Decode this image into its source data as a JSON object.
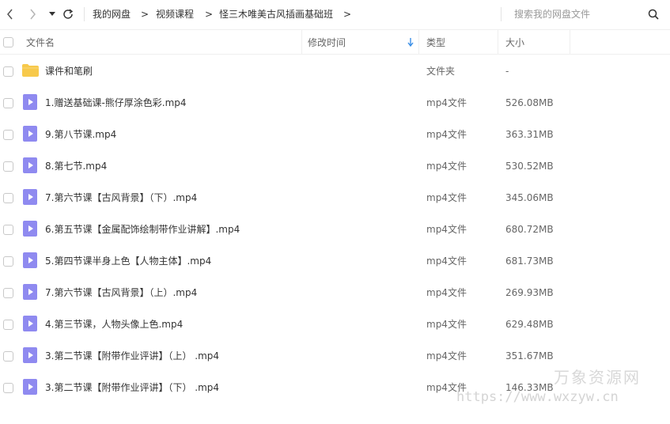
{
  "toolbar": {
    "breadcrumb": [
      "我的网盘",
      "视频课程",
      "怪三木唯美古风插画基础班"
    ],
    "arrow": ">",
    "search_placeholder": "搜索我的网盘文件"
  },
  "header": {
    "name": "文件名",
    "modified": "修改时间",
    "type": "类型",
    "size": "大小"
  },
  "files": [
    {
      "name": "课件和笔刷",
      "type": "文件夹",
      "size": "-",
      "icon": "folder-icon"
    },
    {
      "name": "1.赠送基础课-熊仔厚涂色彩.mp4",
      "type": "mp4文件",
      "size": "526.08MB",
      "icon": "video-file-icon"
    },
    {
      "name": "9.第八节课.mp4",
      "type": "mp4文件",
      "size": "363.31MB",
      "icon": "video-file-icon"
    },
    {
      "name": "8.第七节.mp4",
      "type": "mp4文件",
      "size": "530.52MB",
      "icon": "video-file-icon"
    },
    {
      "name": "7.第六节课【古风背景】（下）.mp4",
      "type": "mp4文件",
      "size": "345.06MB",
      "icon": "video-file-icon"
    },
    {
      "name": "6.第五节课【金属配饰绘制带作业讲解】.mp4",
      "type": "mp4文件",
      "size": "680.72MB",
      "icon": "video-file-icon"
    },
    {
      "name": "5.第四节课半身上色【人物主体】.mp4",
      "type": "mp4文件",
      "size": "681.73MB",
      "icon": "video-file-icon"
    },
    {
      "name": "7.第六节课【古风背景】（上）.mp4",
      "type": "mp4文件",
      "size": "269.93MB",
      "icon": "video-file-icon"
    },
    {
      "name": "4.第三节课，人物头像上色.mp4",
      "type": "mp4文件",
      "size": "629.48MB",
      "icon": "video-file-icon"
    },
    {
      "name": "3.第二节课【附带作业评讲】（上）  .mp4",
      "type": "mp4文件",
      "size": "351.67MB",
      "icon": "video-file-icon"
    },
    {
      "name": "3.第二节课【附带作业评讲】（下）  .mp4",
      "type": "mp4文件",
      "size": "146.33MB",
      "icon": "video-file-icon"
    }
  ],
  "watermark": {
    "line1": "万象资源网",
    "line2": "https://www.wxzyw.cn"
  },
  "colors": {
    "folder": "#f7c94b",
    "video_icon": "#8f8af0",
    "sort_arrow": "#3a8ee6"
  }
}
